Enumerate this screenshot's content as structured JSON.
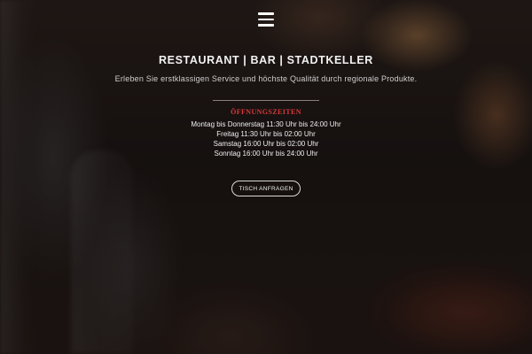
{
  "header": {
    "menu_icon": "hamburger-menu-icon"
  },
  "hero": {
    "title": "RESTAURANT | BAR | STADTKELLER",
    "subtitle": "Erleben Sie erstklassigen Service und höchste Qualität durch regionale Produkte."
  },
  "opening_hours": {
    "heading": "ÖFFNUNGSZEITEN",
    "heading_color": "#d83a3a",
    "lines": [
      "Montag bis Donnerstag 11:30 Uhr bis 24:00 Uhr",
      "Freitag 11:30 Uhr bis 02:00 Uhr",
      "Samstag 16:00 Uhr bis 02:00 Uhr",
      "Sonntag 16:00 Uhr bis 24:00 Uhr"
    ]
  },
  "cta": {
    "label": "TISCH ANFRAGEN"
  }
}
